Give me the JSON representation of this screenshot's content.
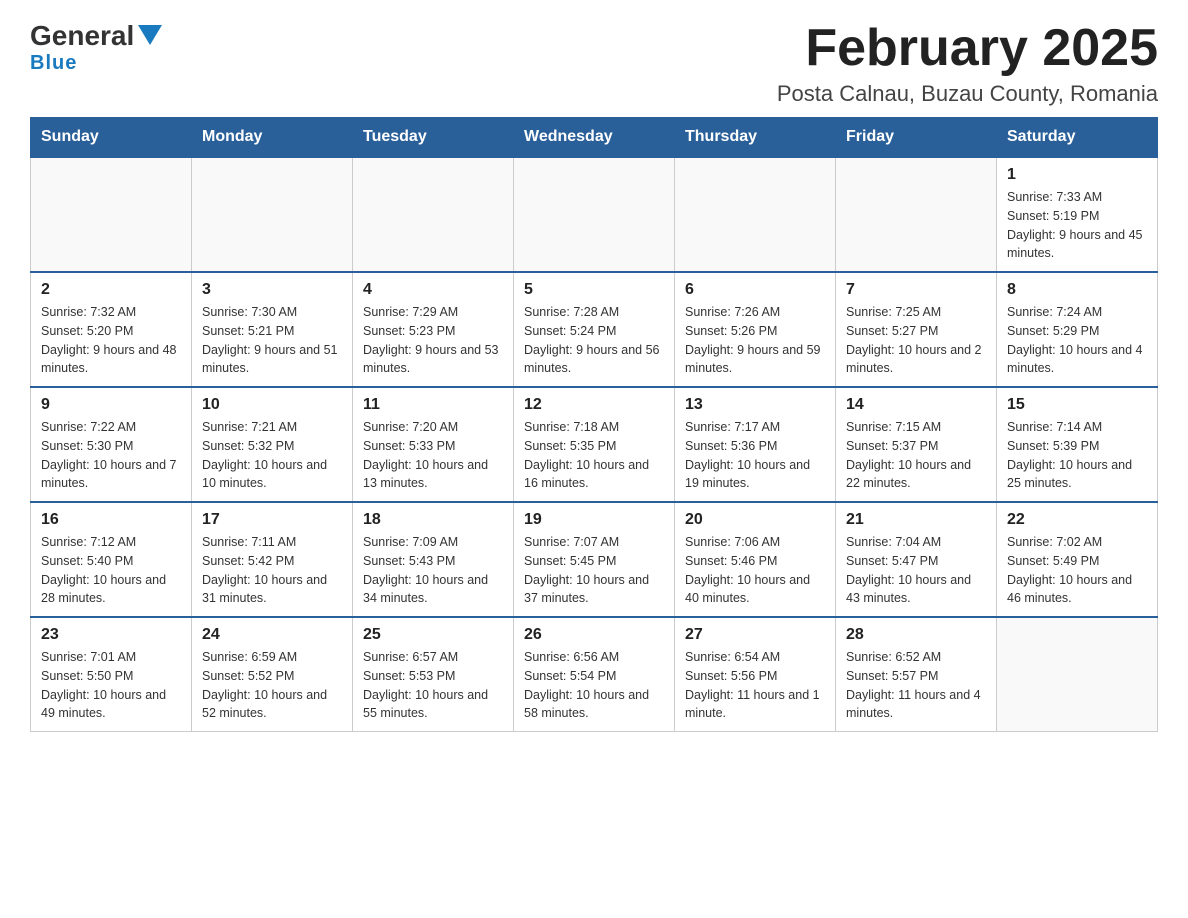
{
  "header": {
    "logo_general": "General",
    "logo_blue": "Blue",
    "month_title": "February 2025",
    "location": "Posta Calnau, Buzau County, Romania"
  },
  "weekdays": [
    "Sunday",
    "Monday",
    "Tuesday",
    "Wednesday",
    "Thursday",
    "Friday",
    "Saturday"
  ],
  "weeks": [
    [
      {
        "day": "",
        "info": ""
      },
      {
        "day": "",
        "info": ""
      },
      {
        "day": "",
        "info": ""
      },
      {
        "day": "",
        "info": ""
      },
      {
        "day": "",
        "info": ""
      },
      {
        "day": "",
        "info": ""
      },
      {
        "day": "1",
        "info": "Sunrise: 7:33 AM\nSunset: 5:19 PM\nDaylight: 9 hours and 45 minutes."
      }
    ],
    [
      {
        "day": "2",
        "info": "Sunrise: 7:32 AM\nSunset: 5:20 PM\nDaylight: 9 hours and 48 minutes."
      },
      {
        "day": "3",
        "info": "Sunrise: 7:30 AM\nSunset: 5:21 PM\nDaylight: 9 hours and 51 minutes."
      },
      {
        "day": "4",
        "info": "Sunrise: 7:29 AM\nSunset: 5:23 PM\nDaylight: 9 hours and 53 minutes."
      },
      {
        "day": "5",
        "info": "Sunrise: 7:28 AM\nSunset: 5:24 PM\nDaylight: 9 hours and 56 minutes."
      },
      {
        "day": "6",
        "info": "Sunrise: 7:26 AM\nSunset: 5:26 PM\nDaylight: 9 hours and 59 minutes."
      },
      {
        "day": "7",
        "info": "Sunrise: 7:25 AM\nSunset: 5:27 PM\nDaylight: 10 hours and 2 minutes."
      },
      {
        "day": "8",
        "info": "Sunrise: 7:24 AM\nSunset: 5:29 PM\nDaylight: 10 hours and 4 minutes."
      }
    ],
    [
      {
        "day": "9",
        "info": "Sunrise: 7:22 AM\nSunset: 5:30 PM\nDaylight: 10 hours and 7 minutes."
      },
      {
        "day": "10",
        "info": "Sunrise: 7:21 AM\nSunset: 5:32 PM\nDaylight: 10 hours and 10 minutes."
      },
      {
        "day": "11",
        "info": "Sunrise: 7:20 AM\nSunset: 5:33 PM\nDaylight: 10 hours and 13 minutes."
      },
      {
        "day": "12",
        "info": "Sunrise: 7:18 AM\nSunset: 5:35 PM\nDaylight: 10 hours and 16 minutes."
      },
      {
        "day": "13",
        "info": "Sunrise: 7:17 AM\nSunset: 5:36 PM\nDaylight: 10 hours and 19 minutes."
      },
      {
        "day": "14",
        "info": "Sunrise: 7:15 AM\nSunset: 5:37 PM\nDaylight: 10 hours and 22 minutes."
      },
      {
        "day": "15",
        "info": "Sunrise: 7:14 AM\nSunset: 5:39 PM\nDaylight: 10 hours and 25 minutes."
      }
    ],
    [
      {
        "day": "16",
        "info": "Sunrise: 7:12 AM\nSunset: 5:40 PM\nDaylight: 10 hours and 28 minutes."
      },
      {
        "day": "17",
        "info": "Sunrise: 7:11 AM\nSunset: 5:42 PM\nDaylight: 10 hours and 31 minutes."
      },
      {
        "day": "18",
        "info": "Sunrise: 7:09 AM\nSunset: 5:43 PM\nDaylight: 10 hours and 34 minutes."
      },
      {
        "day": "19",
        "info": "Sunrise: 7:07 AM\nSunset: 5:45 PM\nDaylight: 10 hours and 37 minutes."
      },
      {
        "day": "20",
        "info": "Sunrise: 7:06 AM\nSunset: 5:46 PM\nDaylight: 10 hours and 40 minutes."
      },
      {
        "day": "21",
        "info": "Sunrise: 7:04 AM\nSunset: 5:47 PM\nDaylight: 10 hours and 43 minutes."
      },
      {
        "day": "22",
        "info": "Sunrise: 7:02 AM\nSunset: 5:49 PM\nDaylight: 10 hours and 46 minutes."
      }
    ],
    [
      {
        "day": "23",
        "info": "Sunrise: 7:01 AM\nSunset: 5:50 PM\nDaylight: 10 hours and 49 minutes."
      },
      {
        "day": "24",
        "info": "Sunrise: 6:59 AM\nSunset: 5:52 PM\nDaylight: 10 hours and 52 minutes."
      },
      {
        "day": "25",
        "info": "Sunrise: 6:57 AM\nSunset: 5:53 PM\nDaylight: 10 hours and 55 minutes."
      },
      {
        "day": "26",
        "info": "Sunrise: 6:56 AM\nSunset: 5:54 PM\nDaylight: 10 hours and 58 minutes."
      },
      {
        "day": "27",
        "info": "Sunrise: 6:54 AM\nSunset: 5:56 PM\nDaylight: 11 hours and 1 minute."
      },
      {
        "day": "28",
        "info": "Sunrise: 6:52 AM\nSunset: 5:57 PM\nDaylight: 11 hours and 4 minutes."
      },
      {
        "day": "",
        "info": ""
      }
    ]
  ]
}
